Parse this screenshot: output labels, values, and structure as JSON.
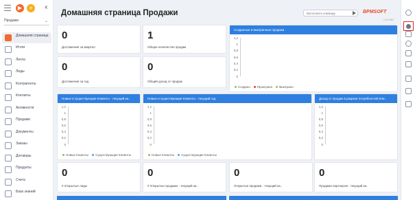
{
  "page_title": "Домашняя страница Продажи",
  "workspace": "Продажи",
  "command_placeholder": "Выполнить команду",
  "brand": "BPMSOFT",
  "version": "1.3.0.390",
  "nav": [
    {
      "label": "Домашняя страница",
      "icon": "home-icon",
      "active": true
    },
    {
      "label": "Итоги",
      "icon": "chart-icon"
    },
    {
      "label": "Лента",
      "icon": "feed-icon"
    },
    {
      "label": "Лиды",
      "icon": "leads-icon"
    },
    {
      "label": "Контрагенты",
      "icon": "accounts-icon"
    },
    {
      "label": "Контакты",
      "icon": "contacts-icon"
    },
    {
      "label": "Активности",
      "icon": "flag-icon"
    },
    {
      "label": "Продажи",
      "icon": "sales-icon"
    },
    {
      "label": "Документы",
      "icon": "documents-icon"
    },
    {
      "label": "Заказы",
      "icon": "cart-icon"
    },
    {
      "label": "Договоры",
      "icon": "contracts-icon"
    },
    {
      "label": "Продукты",
      "icon": "products-icon"
    },
    {
      "label": "Счета",
      "icon": "invoices-icon"
    },
    {
      "label": "База знаний",
      "icon": "knowledge-icon"
    }
  ],
  "metrics": {
    "m1": {
      "value": "0",
      "label": "Достижения за квартал"
    },
    "m2": {
      "value": "1",
      "label": "Общее количество продаж"
    },
    "m3": {
      "value": "0",
      "label": "Достижения за год"
    },
    "m4": {
      "value": "0",
      "label": "Общий доход от продаж"
    },
    "m5": {
      "value": "0",
      "label": "# Открытые лиды"
    },
    "m6": {
      "value": "0",
      "label": "# Открытые продажи - текущий ка.."
    },
    "m7": {
      "value": "0",
      "label": "Открытые продажи - текущий ка.."
    },
    "m8": {
      "value": "0",
      "label": "Продажи партнеров - текущий ка.."
    }
  },
  "charts": {
    "c1": {
      "title": "Созданные и выигранные продажи",
      "ticks": [
        "1,2",
        "1",
        "0,8",
        "0,6",
        "0,4",
        "0,2",
        "0"
      ],
      "legend": [
        "Создано",
        "Проиграно",
        "Выиграно"
      ],
      "colors": [
        "#8bc34a",
        "#e53935",
        "#a0c45a"
      ]
    },
    "c2": {
      "title": "Новые и существующие Клиенты - текущий ка..",
      "ticks": [
        "1,2",
        "1",
        "0,8",
        "0,6",
        "0,4",
        "0,2",
        "0"
      ],
      "legend": [
        "Новые Клиенты",
        "Существующие Клиенты"
      ],
      "colors": [
        "#8bc34a",
        "#5aa0e0"
      ]
    },
    "c3": {
      "title": "Новые и существующие Клиенты - текущий год",
      "ticks": [
        "1,2",
        "1",
        "0,8",
        "0,6",
        "0,4",
        "0,2",
        "0"
      ],
      "legend": [
        "Новые Клиенты",
        "Существующие Клиенты"
      ],
      "colors": [
        "#8bc34a",
        "#5aa0e0"
      ]
    },
    "c4": {
      "title": "Доход от продаж в разрезе потребностей Кли..",
      "ticks": [
        "1,2",
        "1",
        "0,8",
        "0,6",
        "0,4",
        "0,2",
        "0"
      ]
    }
  },
  "chart_data": [
    {
      "type": "bar",
      "title": "Созданные и выигранные продажи",
      "ylim": [
        0,
        1.2
      ],
      "series": [
        {
          "name": "Создано",
          "values": []
        },
        {
          "name": "Проиграно",
          "values": []
        },
        {
          "name": "Выиграно",
          "values": []
        }
      ]
    },
    {
      "type": "bar",
      "title": "Новые и существующие Клиенты - текущий ка..",
      "ylim": [
        0,
        1.2
      ],
      "series": [
        {
          "name": "Новые Клиенты",
          "values": []
        },
        {
          "name": "Существующие Клиенты",
          "values": []
        }
      ]
    },
    {
      "type": "bar",
      "title": "Новые и существующие Клиенты - текущий год",
      "ylim": [
        0,
        1.2
      ],
      "series": [
        {
          "name": "Новые Клиенты",
          "values": []
        },
        {
          "name": "Существующие Клиенты",
          "values": []
        }
      ]
    },
    {
      "type": "bar",
      "title": "Доход от продаж в разрезе потребностей Кли..",
      "ylim": [
        0,
        1.2
      ]
    }
  ],
  "right_icons": [
    "user-icon",
    "clock-icon",
    "gear-icon",
    "help-icon",
    "mail-icon",
    "copy-icon",
    "chat-icon",
    "bell-icon",
    "checklist-icon"
  ]
}
